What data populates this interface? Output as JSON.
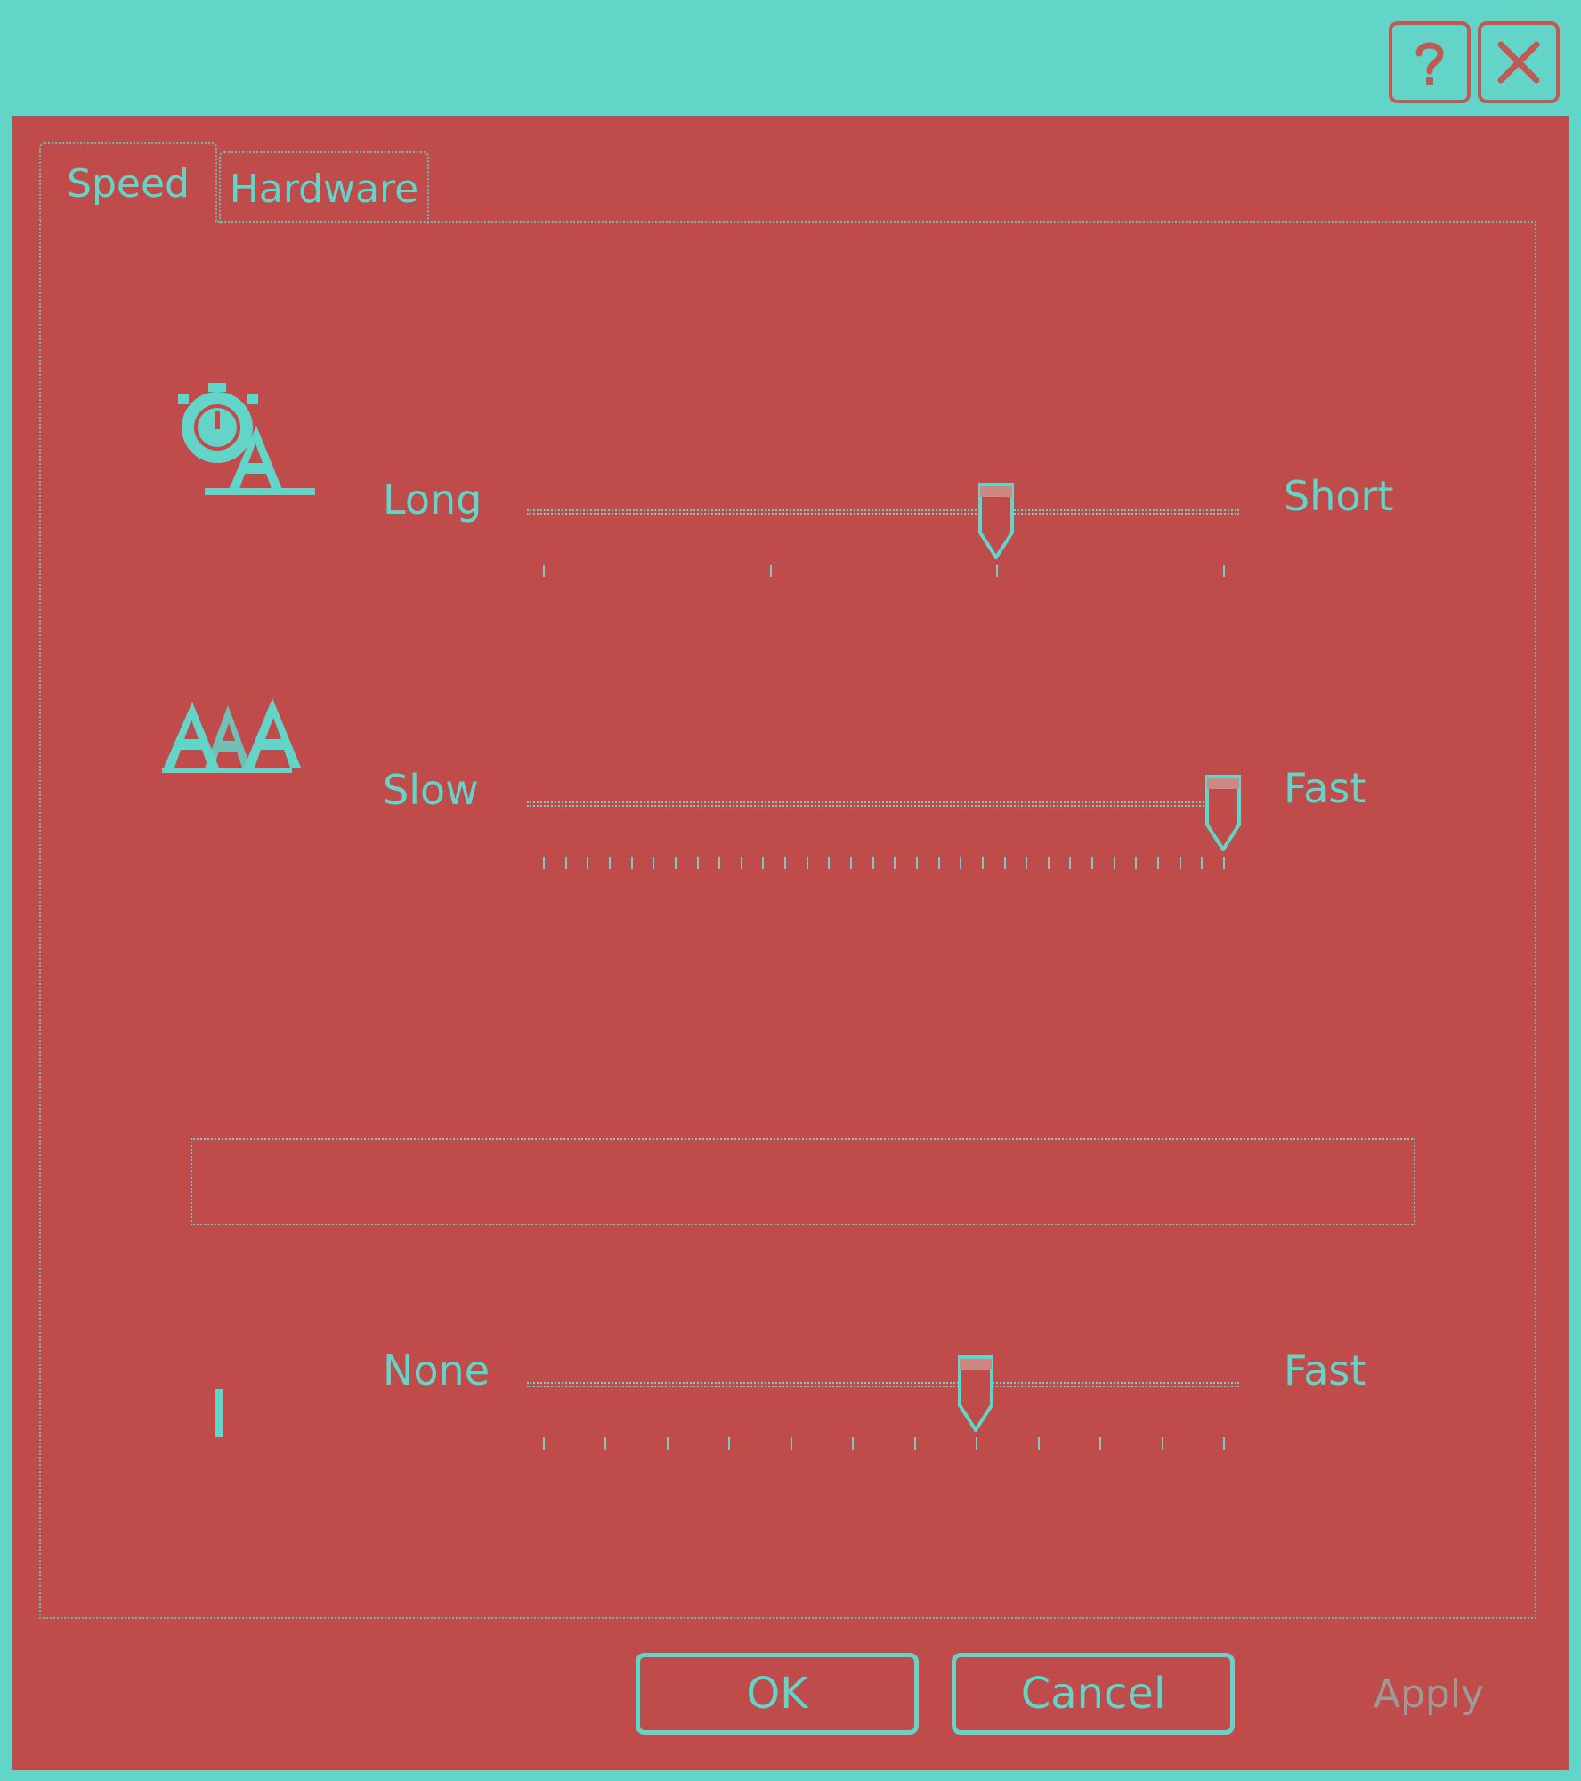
{
  "title_buttons": {
    "help": "?",
    "close": "✕"
  },
  "tabs": [
    {
      "label": "Speed",
      "selected": true
    },
    {
      "label": "Hardware",
      "selected": false
    }
  ],
  "character_repeat": {
    "delay": {
      "left_label": "Long",
      "right_label": "Short",
      "min": 0,
      "max": 3,
      "value": 2
    },
    "rate": {
      "left_label": "Slow",
      "right_label": "Fast",
      "min": 0,
      "max": 31,
      "value": 31
    }
  },
  "test_box": {
    "value": ""
  },
  "cursor_blink": {
    "left_label": "None",
    "right_label": "Fast",
    "min": 0,
    "max": 11,
    "value": 7
  },
  "buttons": {
    "ok": "OK",
    "cancel": "Cancel",
    "apply": "Apply"
  },
  "colors": {
    "background": "#bf4b4a",
    "accent": "#63d4c8"
  }
}
